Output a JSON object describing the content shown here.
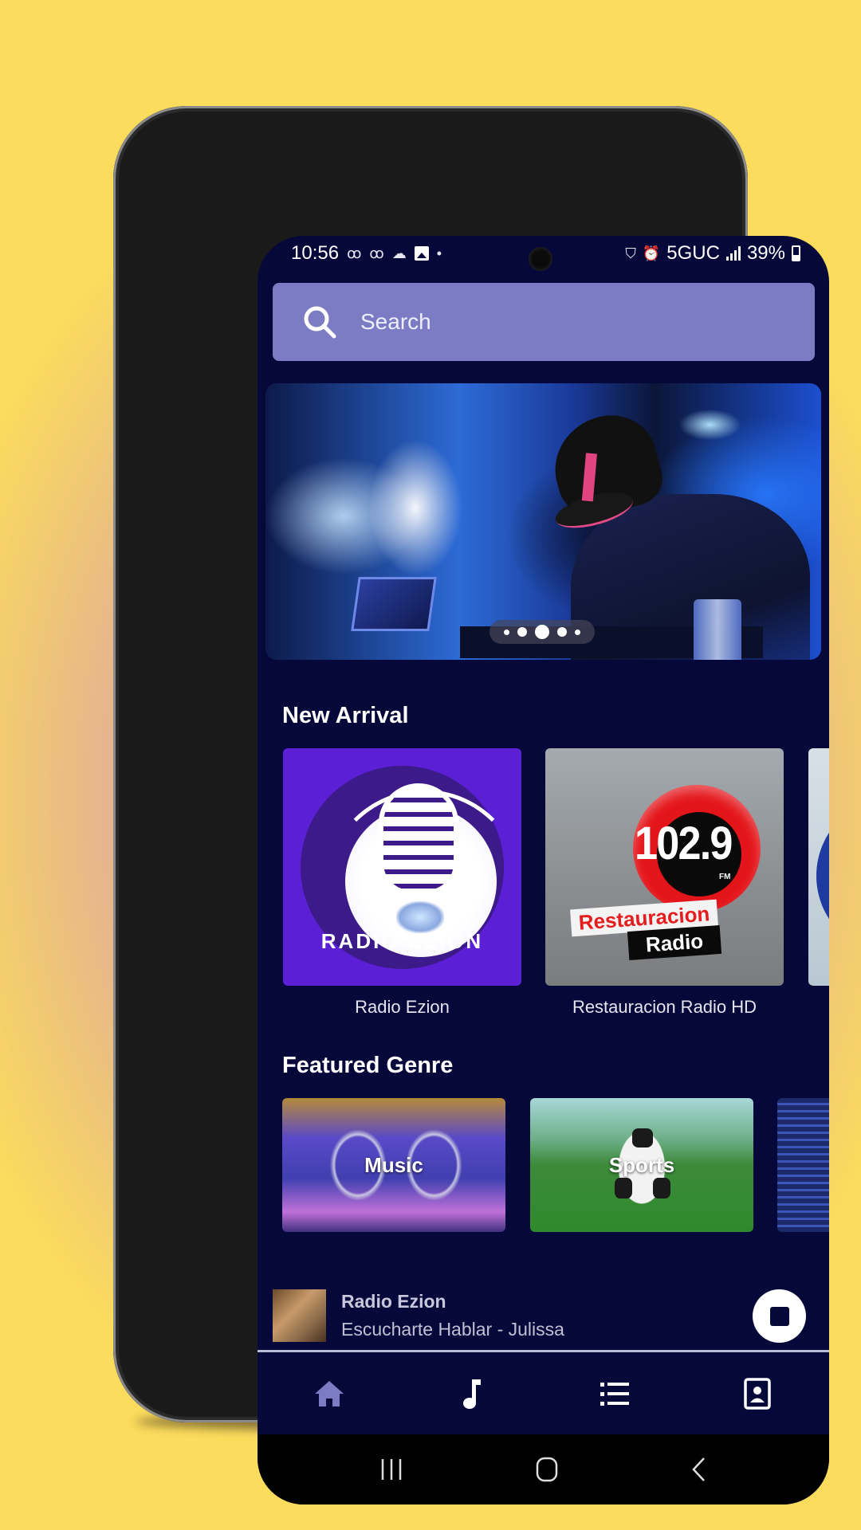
{
  "status_bar": {
    "time": "10:56",
    "left_icons": [
      "voicemail-icon",
      "voicemail-icon",
      "cloud-icon",
      "gallery-icon",
      "dot-icon"
    ],
    "network": "5GUC",
    "battery": "39%",
    "battery_level": 0.39
  },
  "search": {
    "placeholder": "Search",
    "value": ""
  },
  "banner": {
    "slide_count": 5,
    "active_slide": 3
  },
  "new_arrival": {
    "heading": "New Arrival",
    "stations": [
      {
        "name": "Radio Ezion",
        "logo_text": "RADIO EZION"
      },
      {
        "name": "Restauracion Radio HD",
        "logo_frequency": "102.9",
        "logo_band": "FM",
        "logo_line1": "Restauracion",
        "logo_line2": "Radio"
      },
      {
        "name": ""
      }
    ]
  },
  "featured_genre": {
    "heading": "Featured Genre",
    "genres": [
      {
        "label": "Music"
      },
      {
        "label": "Sports"
      },
      {
        "label": ""
      }
    ]
  },
  "now_playing": {
    "station": "Radio Ezion",
    "track": "Escucharte Hablar - Julissa",
    "control": "stop-icon"
  },
  "bottom_nav": {
    "items": [
      {
        "icon": "home-icon",
        "active": true
      },
      {
        "icon": "music-note-icon",
        "active": false
      },
      {
        "icon": "list-icon",
        "active": false
      },
      {
        "icon": "contact-card-icon",
        "active": false
      }
    ],
    "active_color": "#7b7cc4"
  },
  "system_nav": [
    "recent-apps-icon",
    "home-button-icon",
    "back-icon"
  ],
  "colors": {
    "app_background": "#07083a",
    "search_background": "#7b7cc4",
    "text": "#ffffff"
  }
}
